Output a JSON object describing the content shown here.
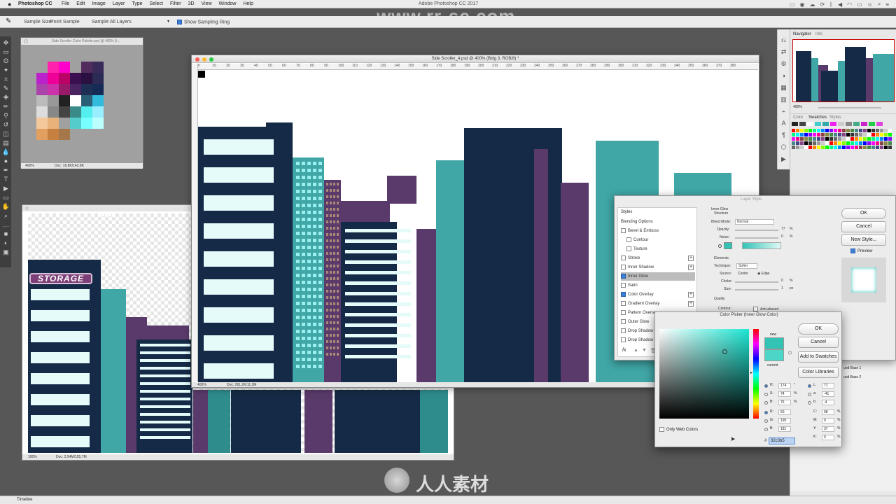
{
  "menubar": {
    "apple": "",
    "app": "Photoshop CC",
    "items": [
      "File",
      "Edit",
      "Image",
      "Layer",
      "Type",
      "Select",
      "Filter",
      "3D",
      "View",
      "Window",
      "Help"
    ],
    "window_title": "Adobe Photoshop CC 2017",
    "watermark": "www.rr-sc.com"
  },
  "options_bar": {
    "sample_size_label": "Sample Size:",
    "sample_size_value": "Point Sample",
    "sample_label": "Sample:",
    "sample_value": "All Layers",
    "ring_label": "Show Sampling Ring"
  },
  "palette_doc": {
    "title": "Side Scroller Color Palette.psd @ 400% (I...",
    "zoom": "400%",
    "doc": "Doc: 18.8K/143.8K"
  },
  "storage_doc": {
    "zoom": "100%",
    "doc": "Doc: 2.54M/155.7M",
    "sign": "STORAGE"
  },
  "main_doc": {
    "title": "Side Scroller_4.psd @ 400% (Bldg 3, RGB/8) *",
    "zoom": "400%",
    "doc": "Doc: 261.2K/11.3M",
    "ruler": [
      "0",
      "10",
      "20",
      "30",
      "40",
      "50",
      "60",
      "70",
      "80",
      "90",
      "100",
      "110",
      "120",
      "130",
      "140",
      "150",
      "160",
      "170",
      "180",
      "190",
      "200",
      "210",
      "220",
      "230",
      "240",
      "250",
      "260",
      "270",
      "280",
      "290",
      "300",
      "310",
      "320",
      "330",
      "340",
      "350",
      "360",
      "370",
      "380"
    ]
  },
  "navigator": {
    "tabs": [
      "Navigator",
      "Info"
    ],
    "zoom": "400%"
  },
  "swatches": {
    "tabs": [
      "Color",
      "Swatches",
      "Styles"
    ],
    "top_colors": [
      "#222",
      "#444",
      "#fff",
      "#4cc",
      "#3aa",
      "#e2e",
      "#ccc",
      "#888",
      "#4a8",
      "#c2c",
      "#2c4",
      "#d4d"
    ]
  },
  "layer_style": {
    "title": "Layer Style",
    "styles_header": "Styles",
    "items": [
      {
        "label": "Blending Options",
        "checked": false,
        "plus": false,
        "selected": false,
        "indent": false
      },
      {
        "label": "Bevel & Emboss",
        "checked": false,
        "plus": false,
        "selected": false,
        "indent": false
      },
      {
        "label": "Contour",
        "checked": false,
        "plus": false,
        "selected": false,
        "indent": true
      },
      {
        "label": "Texture",
        "checked": false,
        "plus": false,
        "selected": false,
        "indent": true
      },
      {
        "label": "Stroke",
        "checked": false,
        "plus": true,
        "selected": false,
        "indent": false
      },
      {
        "label": "Inner Shadow",
        "checked": false,
        "plus": true,
        "selected": false,
        "indent": false
      },
      {
        "label": "Inner Glow",
        "checked": true,
        "plus": false,
        "selected": true,
        "indent": false
      },
      {
        "label": "Satin",
        "checked": false,
        "plus": false,
        "selected": false,
        "indent": false
      },
      {
        "label": "Color Overlay",
        "checked": true,
        "plus": true,
        "selected": false,
        "indent": false
      },
      {
        "label": "Gradient Overlay",
        "checked": false,
        "plus": true,
        "selected": false,
        "indent": false
      },
      {
        "label": "Pattern Overlay",
        "checked": false,
        "plus": false,
        "selected": false,
        "indent": false
      },
      {
        "label": "Outer Glow",
        "checked": false,
        "plus": false,
        "selected": false,
        "indent": false
      },
      {
        "label": "Drop Shadow",
        "checked": false,
        "plus": true,
        "selected": false,
        "indent": false
      },
      {
        "label": "Drop Shadow",
        "checked": false,
        "plus": true,
        "selected": false,
        "indent": false
      }
    ],
    "section": "Inner Glow",
    "structure": "Structure",
    "blend_mode_label": "Blend Mode:",
    "blend_mode": "Normal",
    "opacity_label": "Opacity:",
    "opacity": "77",
    "noise_label": "Noise:",
    "noise": "0",
    "pct": "%",
    "elements": "Elements",
    "technique_label": "Technique:",
    "technique": "Softer",
    "source_label": "Source:",
    "center": "Center",
    "edge": "Edge",
    "choke_label": "Choke:",
    "choke": "0",
    "size_label": "Size:",
    "size": "1",
    "px": "px",
    "quality": "Quality",
    "contour_label": "Contour:",
    "anti_aliased": "Anti-aliased",
    "ok": "OK",
    "cancel": "Cancel",
    "new_style": "New Style...",
    "preview": "Preview"
  },
  "color_picker": {
    "title": "Color Picker (Inner Glow Color)",
    "ok": "OK",
    "cancel": "Cancel",
    "add_to_swatches": "Add to Swatches",
    "color_libraries": "Color Libraries",
    "new_label": "new",
    "current_label": "current",
    "only_web": "Only Web Colors",
    "hsb": [
      {
        "k": "H:",
        "v": "174",
        "u": "°"
      },
      {
        "k": "S:",
        "v": "74",
        "u": "%"
      },
      {
        "k": "B:",
        "v": "76",
        "u": "%"
      }
    ],
    "rgb": [
      {
        "k": "R:",
        "v": "50"
      },
      {
        "k": "G:",
        "v": "195"
      },
      {
        "k": "B:",
        "v": "181"
      }
    ],
    "lab": [
      {
        "k": "L:",
        "v": "71"
      },
      {
        "k": "a:",
        "v": "-41"
      },
      {
        "k": "b:",
        "v": "-4"
      }
    ],
    "cmyk": [
      {
        "k": "C:",
        "v": "68",
        "u": "%"
      },
      {
        "k": "M:",
        "v": "0",
        "u": "%"
      },
      {
        "k": "Y:",
        "v": "37",
        "u": "%"
      },
      {
        "k": "K:",
        "v": "0",
        "u": "%"
      }
    ],
    "hash": "#",
    "hex": "32c3b5",
    "new_color": "#32c3b5",
    "current_color": "#4cd6c8"
  },
  "layers_panel": {
    "items": [
      "und Base",
      "und Base 1",
      "und Base 2"
    ]
  },
  "timeline": {
    "label": "Timeline"
  },
  "footer_watermark": "人人素材"
}
